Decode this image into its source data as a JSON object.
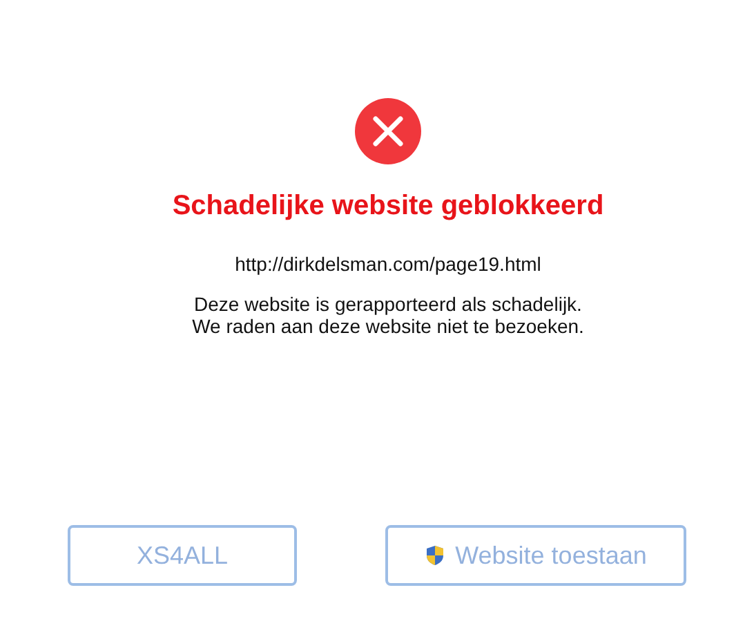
{
  "title": "Schadelijke website geblokkeerd",
  "url": "http://dirkdelsman.com/page19.html",
  "message": [
    "Deze website is gerapporteerd als schadelijk.",
    "We raden aan deze website niet te bezoeken."
  ],
  "buttons": [
    {
      "label": "XS4ALL",
      "kind": "plain"
    },
    {
      "label": "Website toestaan",
      "kind": "shield"
    }
  ]
}
